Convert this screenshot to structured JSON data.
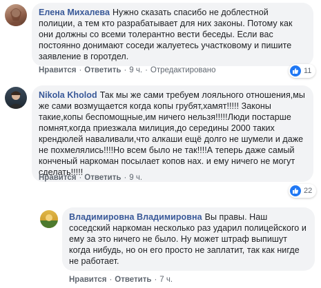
{
  "comments": [
    {
      "author": "Елена Михалева",
      "text": "Нужно сказать спасибо не доблестной полиции, а тем кто разрабатывает для них законы. Потому как они должны со всеми толерантно вести беседы. Если вас постоянно донимают соседи жалуетесь участковому и пишите заявление в горотдел.",
      "like_label": "Нравится",
      "reply_label": "Ответить",
      "time": "9 ч.",
      "edited_label": "Отредактировано",
      "reaction_count": "11"
    },
    {
      "author": "Nikola Kholod",
      "text": "Так мы же сами требуем лояльного отношения,мы же сами возмущается когда копы грубят,хамят!!!!! Законы такие,копы беспомощные,им ничего нельзя!!!!!Люди постарше помнят,когда приезжала милиция,до середины 2000 таких крендюлей навaливали,что алкаши ещё долго не шумели и даже не похмелялись!!!!Но всем было не так!!!!А теперь даже самый конченый наркоман посылает копов нах. и ему ничего не могут сделать!!!!!",
      "like_label": "Нравится",
      "reply_label": "Ответить",
      "time": "9 ч.",
      "reaction_count": "22"
    },
    {
      "author": "Владимировна Владимировна",
      "text": "Вы правы. Наш соседский наркоман несколько раз ударил полицейского и ему за это ничего не было. Ну может штраф выпишут когда нибудь, но он его просто не заплатит, так как нигде не работает.",
      "like_label": "Нравится",
      "reply_label": "Ответить",
      "time": "7 ч."
    }
  ],
  "colors": {
    "author": "#385898",
    "bubble": "#f2f3f5",
    "meta": "#606770",
    "like": "#2078f4"
  },
  "icons": [
    "like-icon",
    "avatar"
  ]
}
